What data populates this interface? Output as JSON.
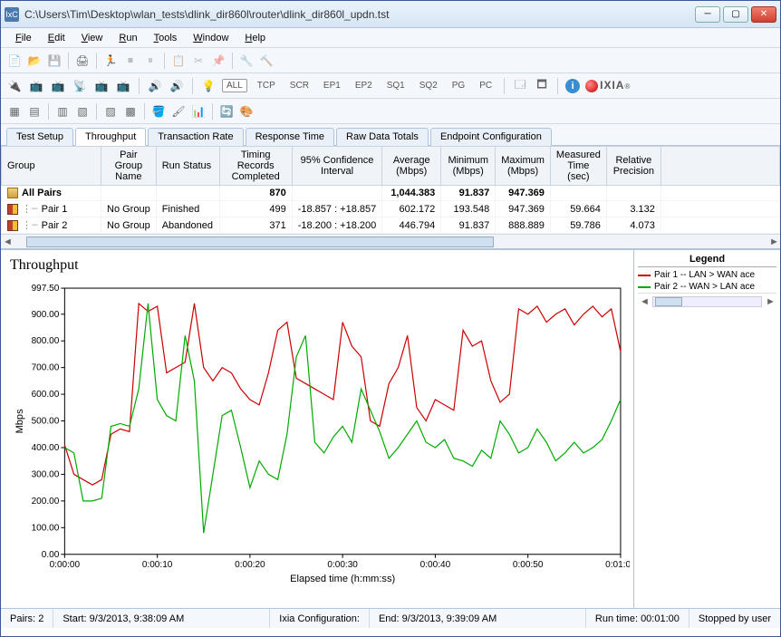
{
  "window": {
    "title": "C:\\Users\\Tim\\Desktop\\wlan_tests\\dlink_dir860l\\router\\dlink_dir860l_updn.tst",
    "app_badge": "IxC"
  },
  "menu": [
    "File",
    "Edit",
    "View",
    "Run",
    "Tools",
    "Window",
    "Help"
  ],
  "toolbar2": {
    "all": "ALL",
    "items": [
      "TCP",
      "SCR",
      "EP1",
      "EP2",
      "SQ1",
      "SQ2",
      "PG",
      "PC"
    ],
    "brand": "IXIA"
  },
  "tabs": {
    "items": [
      "Test Setup",
      "Throughput",
      "Transaction Rate",
      "Response Time",
      "Raw Data Totals",
      "Endpoint Configuration"
    ],
    "active": 1
  },
  "grid": {
    "headers": [
      "Group",
      "Pair Group Name",
      "Run Status",
      "Timing Records Completed",
      "95% Confidence Interval",
      "Average (Mbps)",
      "Minimum (Mbps)",
      "Maximum (Mbps)",
      "Measured Time (sec)",
      "Relative Precision"
    ],
    "rows": [
      {
        "indent": 0,
        "icon": "file",
        "name": "All Pairs",
        "pairgroup": "",
        "status": "",
        "timing": "870",
        "ci": "",
        "avg": "1,044.383",
        "min": "91.837",
        "max": "947.369",
        "meas": "",
        "prec": "",
        "bold": true
      },
      {
        "indent": 1,
        "icon": "book",
        "name": "Pair 1",
        "pairgroup": "No Group",
        "status": "Finished",
        "timing": "499",
        "ci": "-18.857 : +18.857",
        "avg": "602.172",
        "min": "193.548",
        "max": "947.369",
        "meas": "59.664",
        "prec": "3.132",
        "bold": false
      },
      {
        "indent": 1,
        "icon": "book",
        "name": "Pair 2",
        "pairgroup": "No Group",
        "status": "Abandoned",
        "timing": "371",
        "ci": "-18.200 : +18.200",
        "avg": "446.794",
        "min": "91.837",
        "max": "888.889",
        "meas": "59.786",
        "prec": "4.073",
        "bold": false
      }
    ]
  },
  "chart": {
    "title": "Throughput",
    "ylabel": "Mbps",
    "xlabel": "Elapsed time (h:mm:ss)",
    "yticks": [
      "0.00",
      "100.00",
      "200.00",
      "300.00",
      "400.00",
      "500.00",
      "600.00",
      "700.00",
      "800.00",
      "900.00",
      "997.50"
    ],
    "xticks": [
      "0:00:00",
      "0:00:10",
      "0:00:20",
      "0:00:30",
      "0:00:40",
      "0:00:50",
      "0:01:00"
    ]
  },
  "legend": {
    "title": "Legend",
    "items": [
      {
        "color": "#cc0000",
        "label": "Pair 1 -- LAN > WAN ace"
      },
      {
        "color": "#00aa00",
        "label": "Pair 2 -- WAN > LAN ace"
      }
    ]
  },
  "status": {
    "pairs_label": "Pairs:",
    "pairs": "2",
    "start_label": "Start:",
    "start": "9/3/2013, 9:38:09 AM",
    "ixia_label": "Ixia Configuration:",
    "end_label": "End:",
    "end": "9/3/2013, 9:39:09 AM",
    "run_label": "Run time:",
    "run": "00:01:00",
    "stopped": "Stopped by user"
  },
  "chart_data": {
    "type": "line",
    "xlabel": "Elapsed time (h:mm:ss)",
    "ylabel": "Mbps",
    "title": "Throughput",
    "ylim": [
      0,
      997.5
    ],
    "xlim_seconds": [
      0,
      60
    ],
    "x": [
      0,
      1,
      2,
      3,
      4,
      5,
      6,
      7,
      8,
      9,
      10,
      11,
      12,
      13,
      14,
      15,
      16,
      17,
      18,
      19,
      20,
      21,
      22,
      23,
      24,
      25,
      26,
      27,
      28,
      29,
      30,
      31,
      32,
      33,
      34,
      35,
      36,
      37,
      38,
      39,
      40,
      41,
      42,
      43,
      44,
      45,
      46,
      47,
      48,
      49,
      50,
      51,
      52,
      53,
      54,
      55,
      56,
      57,
      58,
      59,
      60
    ],
    "series": [
      {
        "name": "Pair 1 -- LAN > WAN ace",
        "color": "#cc0000",
        "values": [
          410,
          300,
          280,
          260,
          280,
          450,
          470,
          460,
          940,
          910,
          930,
          680,
          700,
          720,
          940,
          700,
          650,
          700,
          680,
          620,
          580,
          560,
          680,
          840,
          870,
          660,
          640,
          620,
          600,
          580,
          870,
          780,
          740,
          500,
          480,
          640,
          700,
          820,
          550,
          500,
          580,
          560,
          540,
          840,
          780,
          800,
          650,
          570,
          600,
          920,
          900,
          930,
          870,
          900,
          920,
          860,
          900,
          930,
          890,
          920,
          760
        ]
      },
      {
        "name": "Pair 2 -- WAN > LAN ace",
        "color": "#00aa00",
        "values": [
          400,
          380,
          200,
          200,
          210,
          480,
          490,
          480,
          620,
          940,
          580,
          520,
          500,
          820,
          650,
          80,
          300,
          520,
          540,
          400,
          250,
          350,
          300,
          280,
          450,
          740,
          820,
          420,
          380,
          440,
          480,
          420,
          620,
          540,
          460,
          360,
          400,
          450,
          500,
          420,
          400,
          430,
          360,
          350,
          330,
          390,
          360,
          500,
          450,
          380,
          400,
          470,
          420,
          350,
          380,
          420,
          380,
          400,
          430,
          500,
          580
        ]
      }
    ]
  }
}
